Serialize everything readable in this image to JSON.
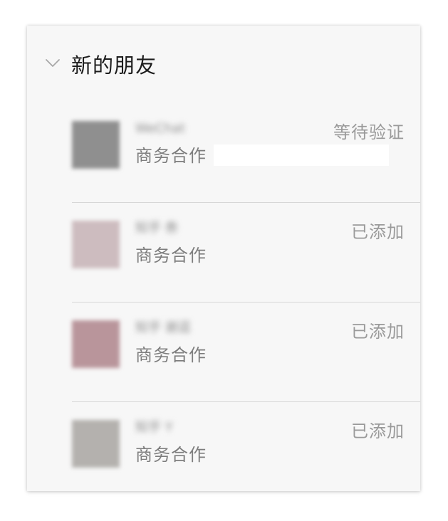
{
  "section": {
    "title": "新的朋友",
    "toggle_icon": "chevron-down-icon"
  },
  "requests": [
    {
      "name": "WeChat",
      "subtitle": "商务合作",
      "status": "等待验证",
      "avatar_color": "#8f8f8f"
    },
    {
      "name": "知乎 叁",
      "subtitle": "商务合作",
      "status": "已添加",
      "avatar_color": "#cdbcbf"
    },
    {
      "name": "知乎 谢逗",
      "subtitle": "商务合作",
      "status": "已添加",
      "avatar_color": "#b9959b"
    },
    {
      "name": "知乎 Y",
      "subtitle": "商务合作",
      "status": "已添加",
      "avatar_color": "#b4b1ae"
    }
  ],
  "colors": {
    "panel_background": "#f7f7f7",
    "title_text": "#1c1c1c",
    "secondary_text": "#7d7d7d",
    "status_text": "#9a9a9a",
    "divider": "#d7d7d7"
  }
}
